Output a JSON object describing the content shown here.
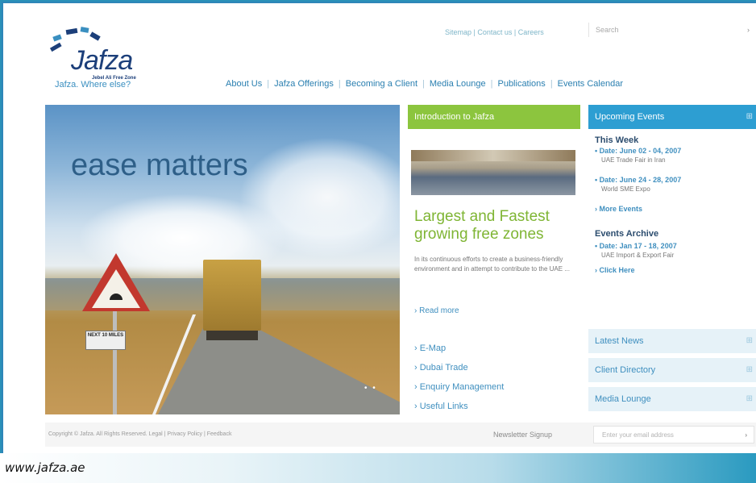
{
  "site": {
    "logo_text": "Jafza",
    "logo_subtext": "Jebel Ali Free Zone",
    "tagline": "Jafza. Where else?"
  },
  "header": {
    "utility_links": "Sitemap | Contact us | Careers",
    "search_placeholder": "Search"
  },
  "nav": [
    {
      "label": "About Us"
    },
    {
      "label": "Jafza Offerings"
    },
    {
      "label": "Becoming a Client"
    },
    {
      "label": "Media Lounge"
    },
    {
      "label": "Publications"
    },
    {
      "label": "Events Calendar"
    }
  ],
  "hero": {
    "headline": "ease matters",
    "sign_text": "NEXT 10 MILES",
    "pager": "• •"
  },
  "intro": {
    "bar_title": "Introduction to Jafza",
    "headline": "Largest and Fastest growing free zones",
    "blurb": "In its continuous efforts to create a business-friendly environment and in attempt to contribute to the UAE ...",
    "read_more": "› Read more"
  },
  "quick_links": [
    {
      "label": "› E-Map"
    },
    {
      "label": "› Dubai Trade"
    },
    {
      "label": "› Enquiry Management"
    },
    {
      "label": "› Useful Links"
    }
  ],
  "events": {
    "bar_title": "Upcoming Events",
    "this_week": "This Week",
    "items": [
      {
        "date": "• Date: June 02 - 04, 2007",
        "name": "UAE Trade Fair in Iran"
      },
      {
        "date": "• Date: June 24 - 28, 2007",
        "name": "World SME Expo"
      }
    ],
    "more_events": "› More Events",
    "archive_title": "Events Archive",
    "archive_item": {
      "date": "• Date: Jan 17 - 18, 2007",
      "name": "UAE Import & Export Fair"
    },
    "click_here": "› Click Here"
  },
  "boxes": [
    {
      "label": "Latest News"
    },
    {
      "label": "Client Directory"
    },
    {
      "label": "Media Lounge"
    }
  ],
  "footer": {
    "copyright": "Copyright © Jafza. All Rights Reserved. Legal | Privacy Policy | Feedback",
    "newsletter_label": "Newsletter Signup",
    "email_placeholder": "Enter your email address"
  },
  "caption": "www.jafza.ae",
  "colors": {
    "green": "#8cc53e",
    "blue": "#2d9ed2",
    "link": "#3f8fbf"
  }
}
